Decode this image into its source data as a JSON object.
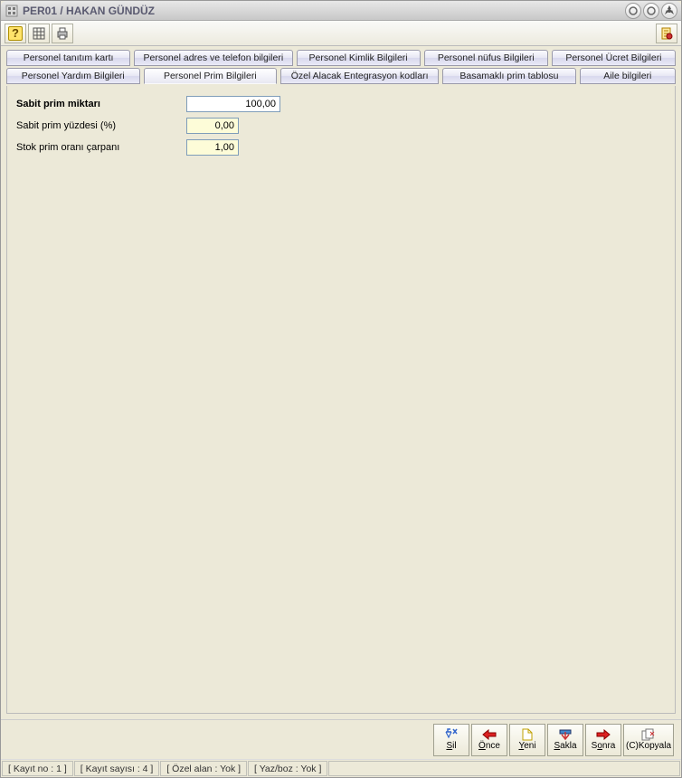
{
  "window": {
    "title": "PER01 / HAKAN GÜNDÜZ"
  },
  "tabs": {
    "row1": [
      "Personel tanıtım kartı",
      "Personel adres ve telefon bilgileri",
      "Personel Kimlik Bilgileri",
      "Personel nüfus Bilgileri",
      "Personel Ücret Bilgileri"
    ],
    "row2": [
      "Personel Yardım Bilgileri",
      "Personel Prim Bilgileri",
      "Özel Alacak Entegrasyon kodları",
      "Basamaklı prim tablosu",
      "Aile bilgileri"
    ],
    "active": "Personel Prim Bilgileri"
  },
  "form": {
    "sabit_prim_miktari": {
      "label": "Sabit prim miktarı",
      "value": "100,00"
    },
    "sabit_prim_yuzdesi": {
      "label": "Sabit prim yüzdesi (%)",
      "value": "0,00"
    },
    "stok_prim_orani_carpani": {
      "label": "Stok prim oranı çarpanı",
      "value": "1,00"
    }
  },
  "buttons": {
    "sil": "Sil",
    "once": "Önce",
    "yeni": "Yeni",
    "sakla": "Sakla",
    "sonra": "Sonra",
    "kopyala": "(C)Kopyala"
  },
  "status": {
    "kayit_no": "[ Kayıt no : 1 ]",
    "kayit_sayisi": "[ Kayıt sayısı : 4 ]",
    "ozel_alan": "[ Özel alan : Yok ]",
    "yaz_boz": "[ Yaz/boz : Yok ]"
  }
}
